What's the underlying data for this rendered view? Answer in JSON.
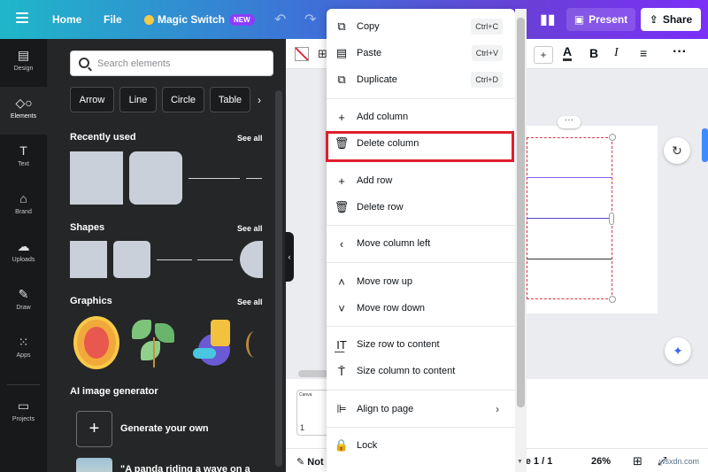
{
  "topbar": {
    "home": "Home",
    "file": "File",
    "magic_switch": "Magic Switch",
    "new_badge": "NEW",
    "present": "Present",
    "share": "Share"
  },
  "rail": {
    "items": [
      {
        "label": "Design",
        "icon": "layout-icon"
      },
      {
        "label": "Elements",
        "icon": "elements-icon"
      },
      {
        "label": "Text",
        "icon": "text-icon"
      },
      {
        "label": "Brand",
        "icon": "brand-icon"
      },
      {
        "label": "Uploads",
        "icon": "upload-icon"
      },
      {
        "label": "Draw",
        "icon": "draw-icon"
      },
      {
        "label": "Apps",
        "icon": "apps-icon"
      },
      {
        "label": "Projects",
        "icon": "folder-icon"
      }
    ]
  },
  "panel": {
    "search_placeholder": "Search elements",
    "chips": [
      "Arrow",
      "Line",
      "Circle",
      "Table"
    ],
    "recently_used": "Recently used",
    "shapes": "Shapes",
    "graphics": "Graphics",
    "see_all": "See all",
    "ai_generator": "AI image generator",
    "generate_your_own": "Generate your own",
    "panda_prompt": "\"A panda riding a wave on a"
  },
  "menu": {
    "copy": "Copy",
    "copy_shortcut": "Ctrl+C",
    "paste": "Paste",
    "paste_shortcut": "Ctrl+V",
    "duplicate": "Duplicate",
    "duplicate_shortcut": "Ctrl+D",
    "add_column": "Add column",
    "delete_column": "Delete column",
    "add_row": "Add row",
    "delete_row": "Delete row",
    "move_column_left": "Move column left",
    "move_row_up": "Move row up",
    "move_row_down": "Move row down",
    "size_row_to_content": "Size row to content",
    "size_column_to_content": "Size column to content",
    "align_to_page": "Align to page",
    "lock": "Lock"
  },
  "bottom": {
    "notes": "Not",
    "page": "ge 1 / 1",
    "zoom": "26%",
    "thumb_label": "1",
    "thumb_text": "Canva"
  },
  "watermark": "wsxdn.com",
  "colors": {
    "highlight": "#e01e2d",
    "panel_bg": "#252627",
    "rail_bg": "#18191b",
    "accent": "#8b3dff"
  }
}
